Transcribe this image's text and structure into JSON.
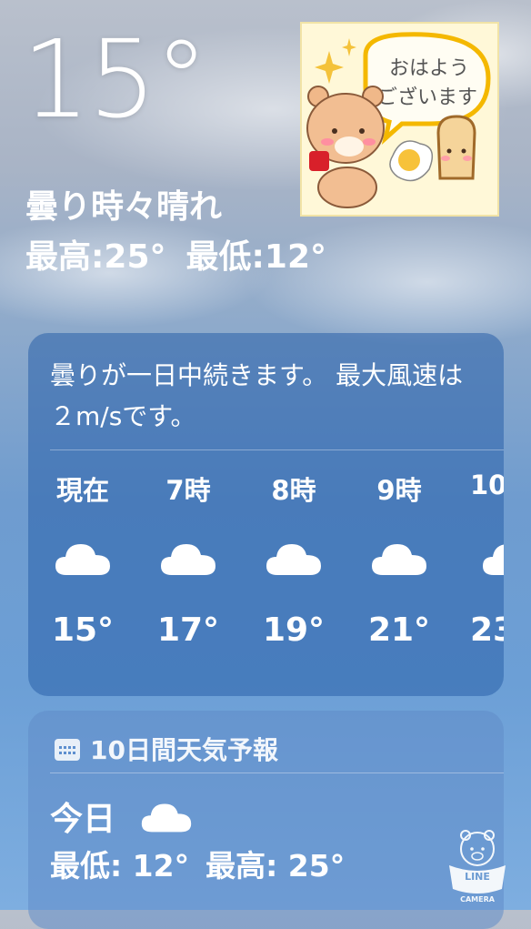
{
  "current": {
    "temperature": "15°",
    "condition": "曇り時々晴れ",
    "high": "最高:25°",
    "low": "最低:12°"
  },
  "sticker": {
    "greeting_line1": "おはよう",
    "greeting_line2": "ございます"
  },
  "hourly": {
    "summary": "曇りが一日中続きます。 最大風速は２m/sです。",
    "items": [
      {
        "label": "現在",
        "icon": "cloud-icon",
        "temp": "15°"
      },
      {
        "label": "7時",
        "icon": "cloud-icon",
        "temp": "17°"
      },
      {
        "label": "8時",
        "icon": "cloud-icon",
        "temp": "19°"
      },
      {
        "label": "9時",
        "icon": "cloud-icon",
        "temp": "21°"
      },
      {
        "label": "10",
        "icon": "cloud-icon",
        "temp": "23"
      }
    ]
  },
  "forecast": {
    "header": "10日間天気予報",
    "today_label": "今日",
    "today_icon": "cloud-icon",
    "today_low": "最低: 12°",
    "today_high": "最高: 25°"
  },
  "watermark": {
    "line1": "LINE",
    "line2": "CAMERA"
  }
}
